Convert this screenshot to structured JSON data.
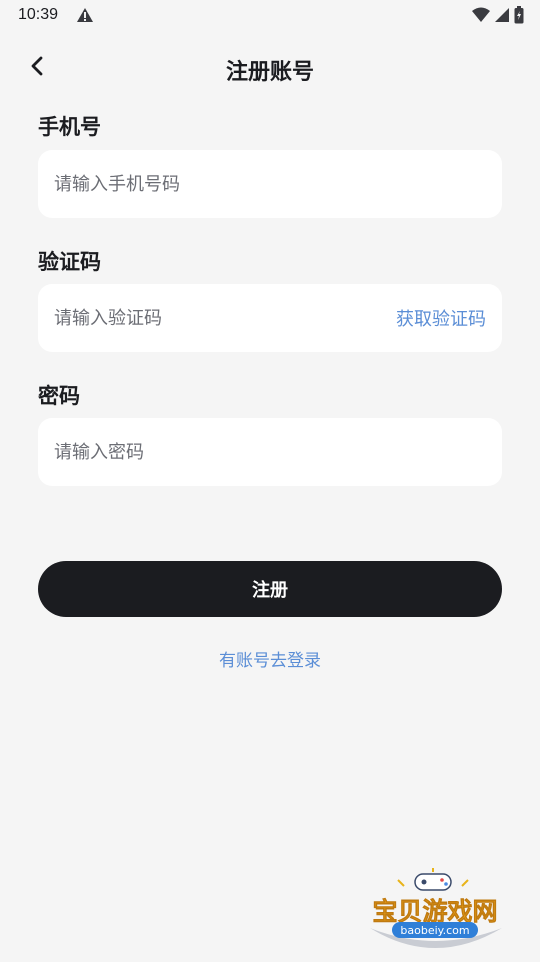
{
  "status_bar": {
    "time": "10:39"
  },
  "header": {
    "title": "注册账号"
  },
  "form": {
    "phone": {
      "label": "手机号",
      "placeholder": "请输入手机号码"
    },
    "code": {
      "label": "验证码",
      "placeholder": "请输入验证码",
      "get_code_label": "获取验证码"
    },
    "password": {
      "label": "密码",
      "placeholder": "请输入密码"
    },
    "submit_label": "注册",
    "login_link": "有账号去登录"
  },
  "watermark": {
    "brand": "宝贝游戏网",
    "domain": "baobeiy.com"
  },
  "colors": {
    "background": "#f5f5f5",
    "primary_button": "#1b1c20",
    "link": "#5b8ed6",
    "input_bg": "#ffffff"
  }
}
